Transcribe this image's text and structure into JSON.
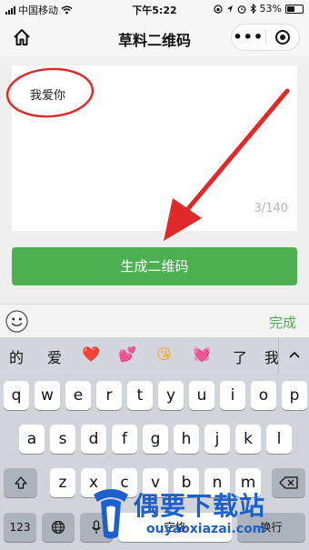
{
  "status_bar": {
    "carrier": "中国移动",
    "time": "下午5:22",
    "battery": "53%",
    "battery_level": 0.53
  },
  "nav": {
    "title": "草料二维码",
    "capsule_more": "•••"
  },
  "input": {
    "text": "我爱你",
    "counter": "3/140"
  },
  "generate_button": "生成二维码",
  "toolbar": {
    "done": "完成"
  },
  "candidates": [
    "的",
    "爱",
    "❤️",
    "💕",
    "😘",
    "💓",
    "了",
    "我"
  ],
  "keyboard": {
    "row1": [
      "q",
      "w",
      "e",
      "r",
      "t",
      "y",
      "u",
      "i",
      "o",
      "p"
    ],
    "row2": [
      "a",
      "s",
      "d",
      "f",
      "g",
      "h",
      "j",
      "k",
      "l"
    ],
    "row3": [
      "z",
      "x",
      "c",
      "v",
      "b",
      "n",
      "m"
    ],
    "numbers": "123",
    "space": "空格",
    "return_key": "换行"
  },
  "watermark": {
    "text": "偶要下载站",
    "url": "ouyaoxiazai.com"
  },
  "colors": {
    "accent": "#4caf50",
    "annotation": "#e02a2a",
    "watermark": "#1d5fcc"
  }
}
